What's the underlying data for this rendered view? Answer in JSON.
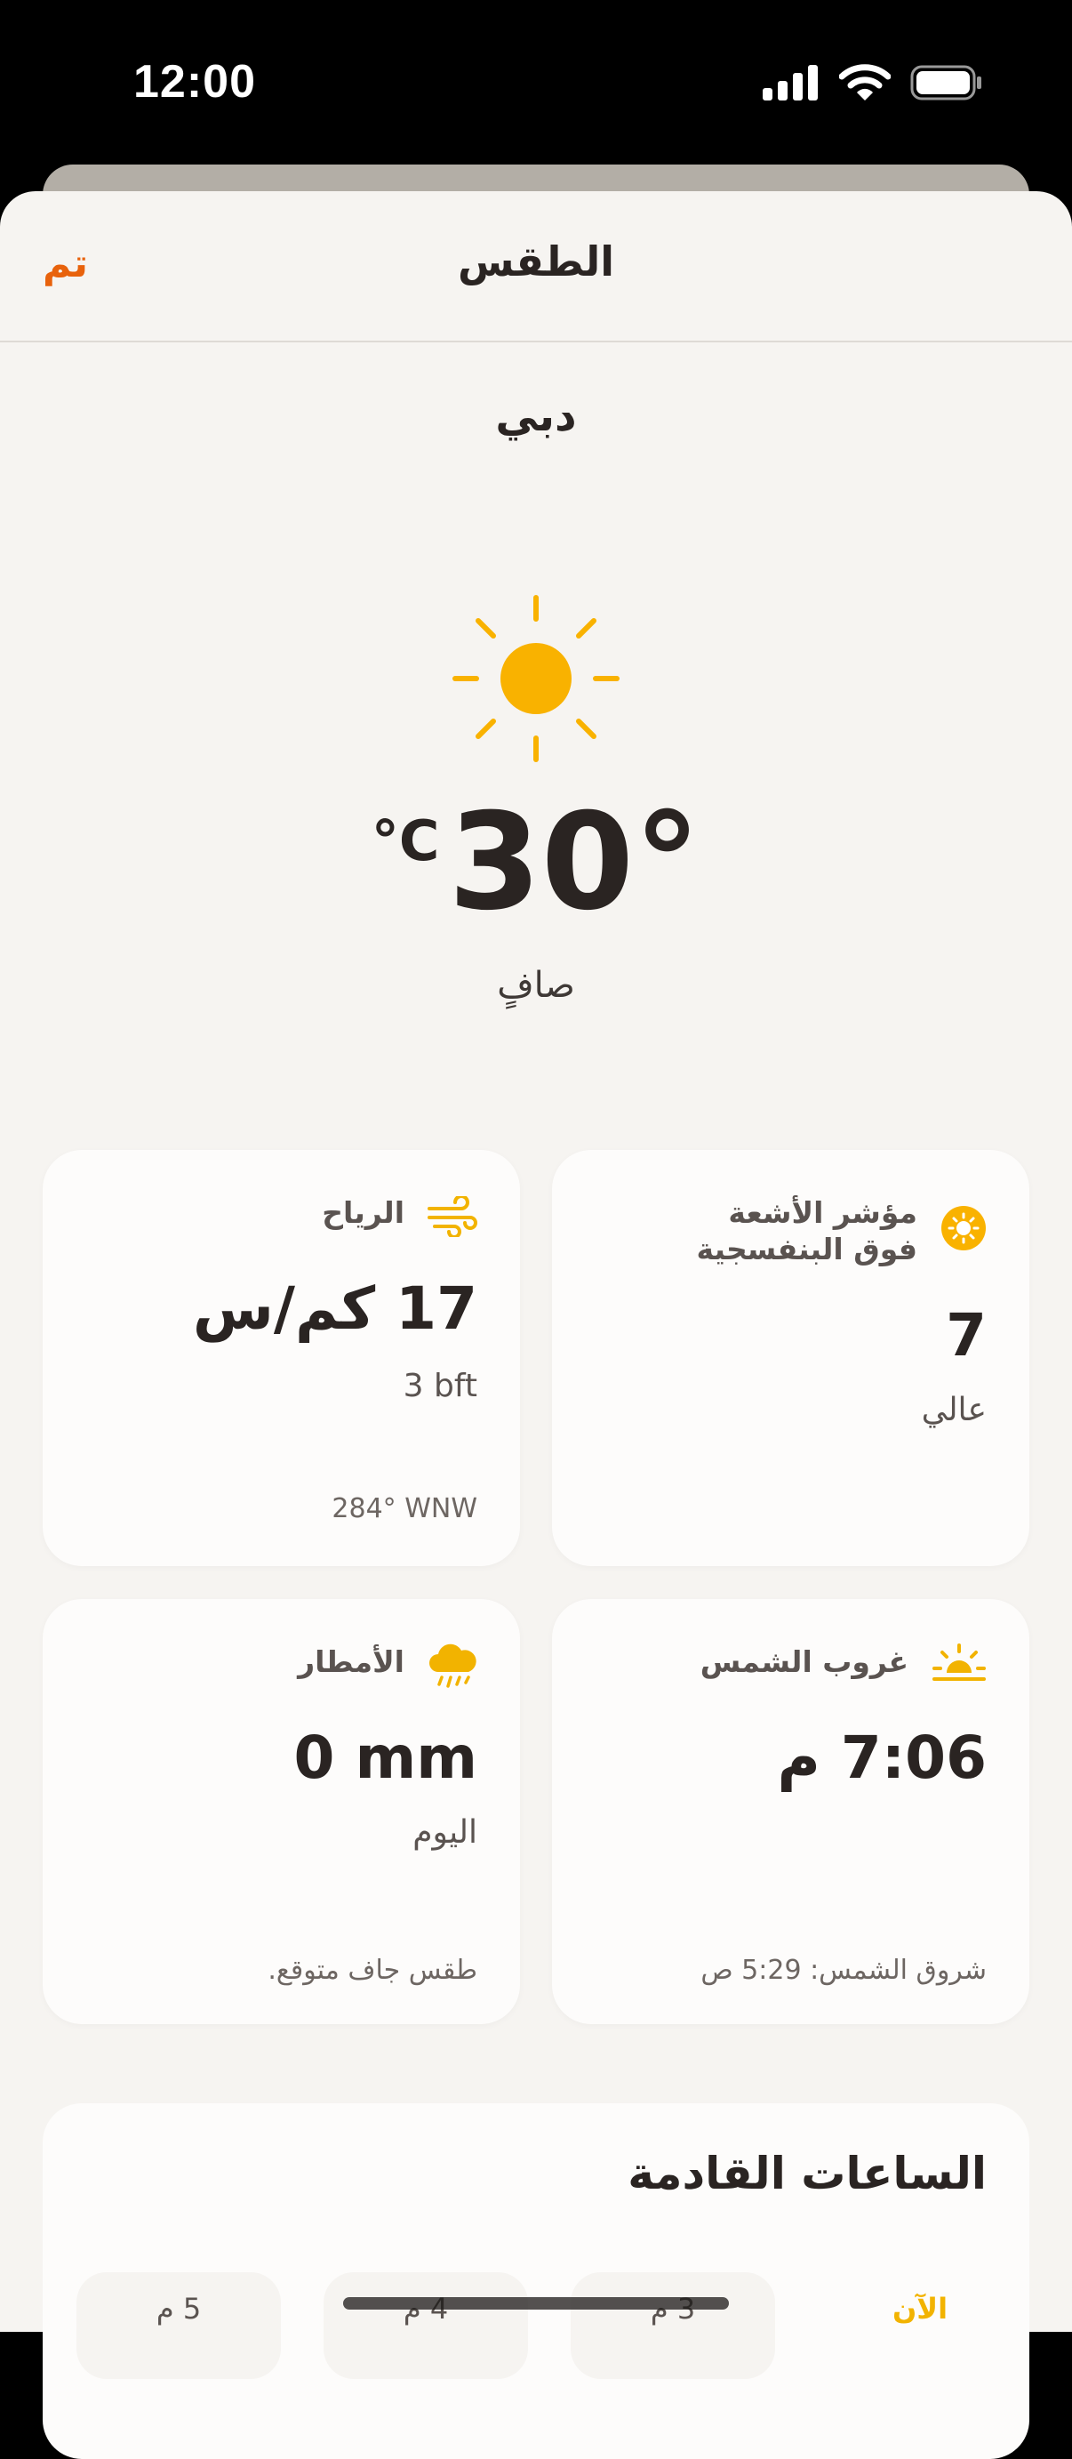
{
  "status_bar": {
    "time": "12:00"
  },
  "nav": {
    "title": "الطقس",
    "done_label": "تم"
  },
  "current": {
    "city": "دبي",
    "temp_value": "30°",
    "temp_unit": "°C",
    "condition": "صافٍ"
  },
  "cards": {
    "uv": {
      "label": "مؤشر الأشعة فوق البنفسجية",
      "value": "7",
      "sub": "عالي"
    },
    "wind": {
      "label": "الرياح",
      "value": "17 كم/س",
      "sub": "3 bft",
      "foot": "284° WNW"
    },
    "sunset": {
      "label": "غروب الشمس",
      "value": "7:06 م",
      "foot": "شروق الشمس: 5:29 ص"
    },
    "rain": {
      "label": "الأمطار",
      "value": "0 mm",
      "sub": "اليوم",
      "foot": "طقس جاف متوقع."
    }
  },
  "forecast": {
    "title": "الساعات القادمة",
    "hours": [
      {
        "label": "الآن"
      },
      {
        "label": "3 م"
      },
      {
        "label": "4 م"
      },
      {
        "label": "5 م"
      }
    ]
  },
  "colors": {
    "accent": "#e8620c",
    "sun": "#f9b200",
    "background": "#f6f4f1",
    "card": "#fdfcfb"
  }
}
